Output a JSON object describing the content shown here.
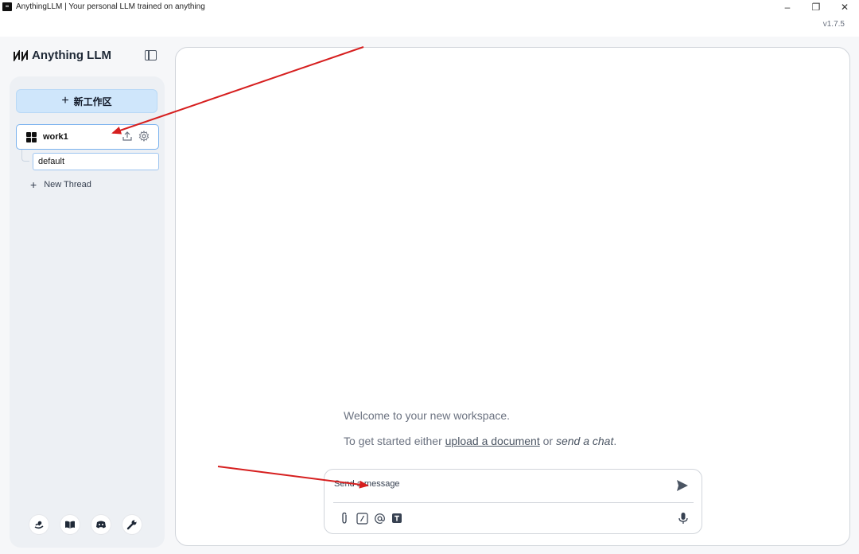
{
  "window": {
    "title": "AnythingLLM | Your personal LLM trained on anything",
    "app_icon_text": "∞",
    "minimize": "–",
    "restore": "❐",
    "close": "✕",
    "version": "v1.7.5"
  },
  "sidebar": {
    "brand_logo": "🝙",
    "brand_name": "Anything LLM",
    "new_workspace_label": "新工作区",
    "workspaces": [
      {
        "name": "work1",
        "threads": [
          {
            "name": "default"
          }
        ]
      }
    ],
    "new_thread_label": "New Thread",
    "footer_icons": [
      "community-hub-icon",
      "docs-book-icon",
      "discord-icon",
      "settings-wrench-icon"
    ]
  },
  "main": {
    "welcome_text": "Welcome to your new workspace.",
    "get_started_prefix": "To get started either ",
    "upload_link": "upload a document",
    "get_started_or": " or ",
    "send_chat_link": "send a chat",
    "get_started_suffix": ".",
    "composer": {
      "placeholder": "Send a message",
      "tools": [
        "attach-icon",
        "slash-command-icon",
        "at-mention-icon",
        "text-size-icon"
      ]
    }
  },
  "colors": {
    "new_workspace_bg": "#cfe6fb",
    "active_border": "#7ab2ee",
    "annotation_arrow": "#d61f1f"
  }
}
